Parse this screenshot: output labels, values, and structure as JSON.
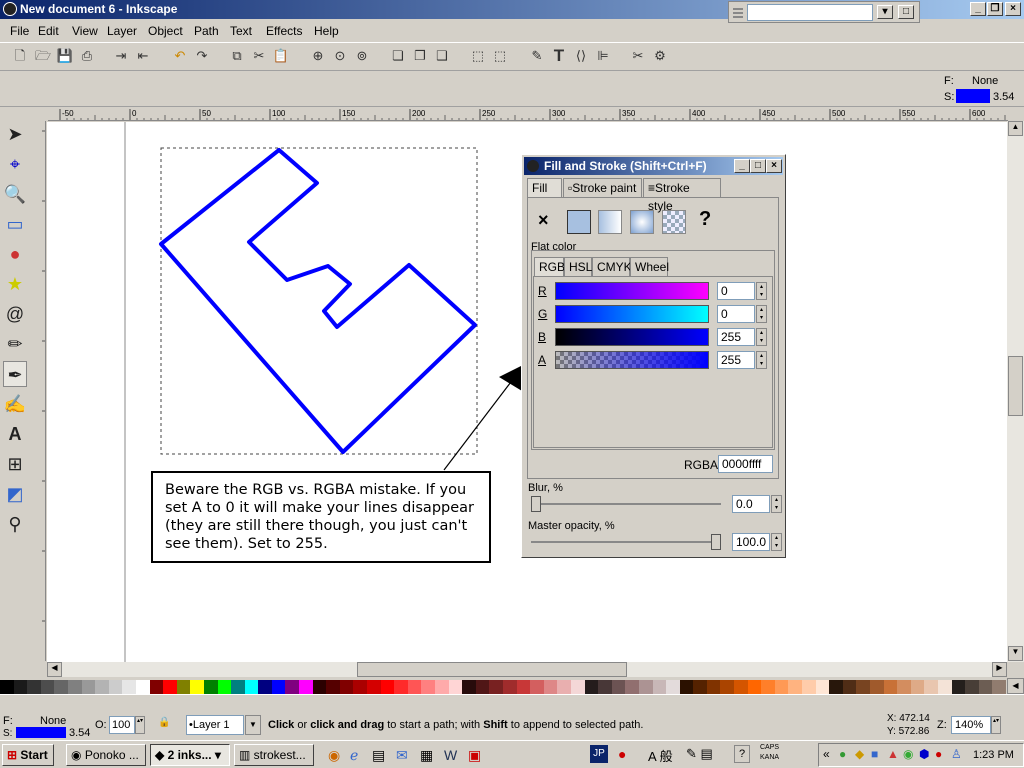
{
  "window": {
    "title": "New document 6 - Inkscape"
  },
  "menu": [
    "File",
    "Edit",
    "View",
    "Layer",
    "Object",
    "Path",
    "Text",
    "Effects",
    "Help"
  ],
  "ctrl": {
    "fill_label": "F:",
    "fill_value": "None",
    "stroke_label": "S:",
    "stroke_value": "3.54"
  },
  "ruler_h": [
    "-50",
    "0",
    "50",
    "100",
    "150",
    "200",
    "250",
    "300",
    "350",
    "400",
    "450",
    "500",
    "550",
    "600"
  ],
  "dialog": {
    "title": "Fill and Stroke (Shift+Ctrl+F)",
    "tabs": [
      "Fill",
      "Stroke paint",
      "Stroke style"
    ],
    "flat_color": "Flat color",
    "mode_tabs": [
      "RGB",
      "HSL",
      "CMYK",
      "Wheel"
    ],
    "channels": [
      {
        "label": "R",
        "value": "0"
      },
      {
        "label": "G",
        "value": "0"
      },
      {
        "label": "B",
        "value": "255"
      },
      {
        "label": "A",
        "value": "255"
      }
    ],
    "rgba_label": "RGBA:",
    "rgba_value": "0000ffff",
    "blur_label": "Blur, %",
    "blur_value": "0.0",
    "opacity_label": "Master opacity, %",
    "opacity_value": "100.0"
  },
  "callout": "Beware the RGB vs. RGBA mistake. If you set A to 0 it will make your lines disappear (they are still there though, you just can't see them). Set to 255.",
  "status": {
    "fill_label": "F:",
    "fill_value": "None",
    "stroke_label": "S:",
    "stroke_value": "3.54",
    "opacity_label": "O:",
    "opacity_value": "100",
    "layer": "•Layer 1",
    "message_b1": "Click",
    "message_t1": " or ",
    "message_b2": "click and drag",
    "message_t2": " to start a path; with ",
    "message_b3": "Shift",
    "message_t3": " to append to selected path.",
    "x_label": "X: 472.14",
    "y_label": "Y: 572.86",
    "zoom_label": "Z:",
    "zoom_value": "140%"
  },
  "taskbar": {
    "start": "Start",
    "tasks": [
      "Ponoko ...",
      "2 inks...",
      "strokest..."
    ],
    "ime": "JP",
    "caps": "CAPS",
    "kana": "KANA",
    "clock": "1:23 PM"
  },
  "colors": {
    "accent_blue": "#0000ff",
    "title_dark": "#0a246a",
    "title_light": "#a6caf0"
  }
}
